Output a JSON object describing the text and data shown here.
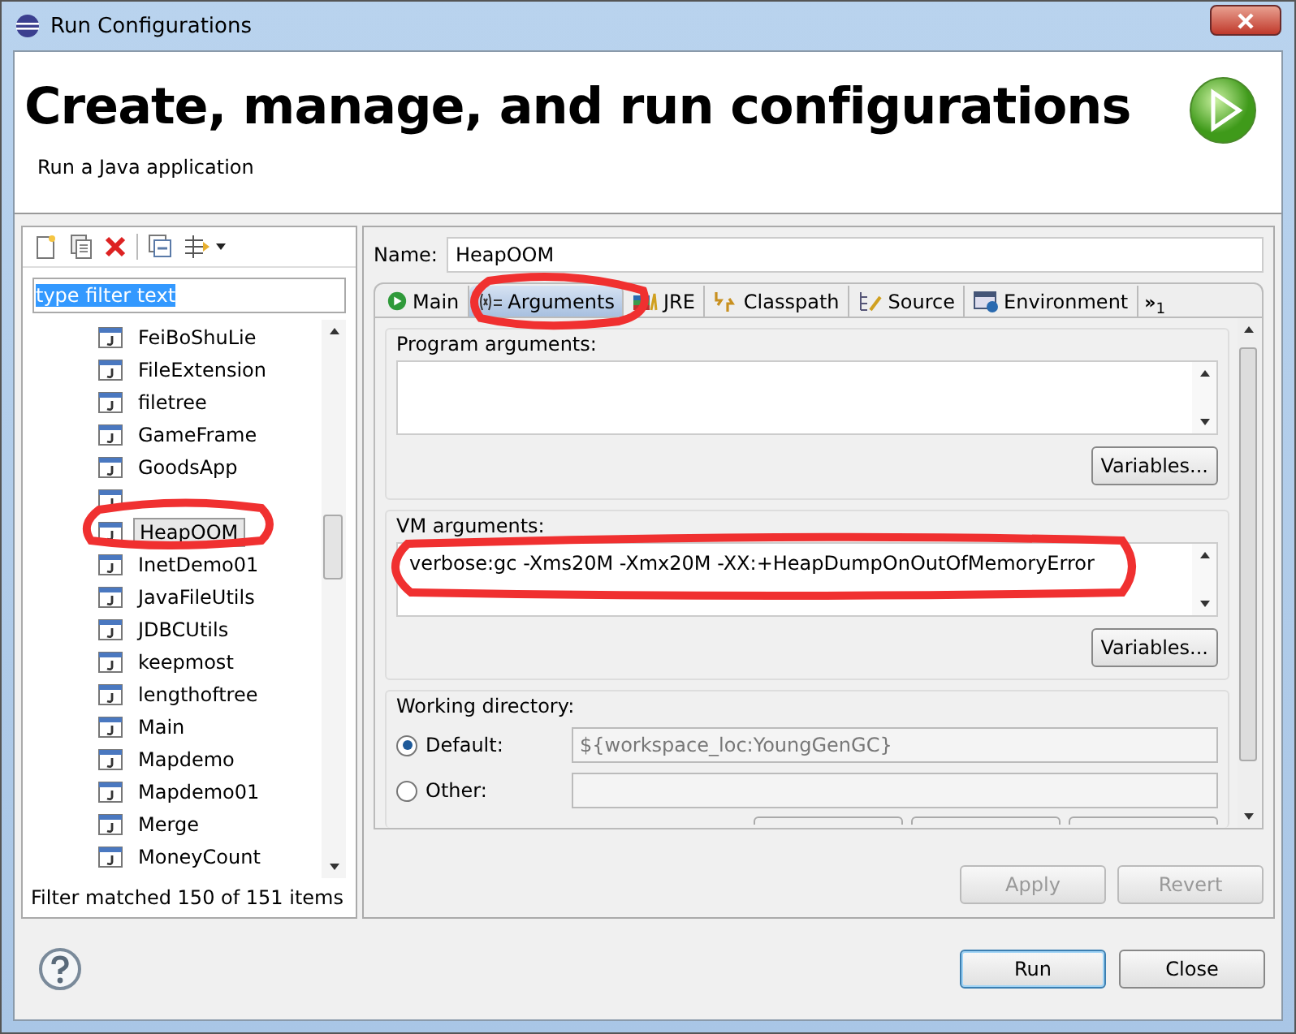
{
  "window": {
    "title": "Run Configurations"
  },
  "banner": {
    "heading": "Create, manage, and run configurations",
    "subtitle": "Run a Java application"
  },
  "filter": {
    "value": "type filter text"
  },
  "tree": {
    "items": [
      {
        "label": "FeiBoShuLie",
        "selected": false
      },
      {
        "label": "FileExtension",
        "selected": false
      },
      {
        "label": "filetree",
        "selected": false
      },
      {
        "label": "GameFrame",
        "selected": false
      },
      {
        "label": "GoodsApp",
        "selected": false
      },
      {
        "selected": false
      },
      {
        "label": "HeapOOM",
        "selected": true
      },
      {
        "label": "InetDemo01",
        "selected": false
      },
      {
        "label": "JavaFileUtils",
        "selected": false
      },
      {
        "label": "JDBCUtils",
        "selected": false
      },
      {
        "label": "keepmost",
        "selected": false
      },
      {
        "label": "lengthoftree",
        "selected": false
      },
      {
        "label": "Main",
        "selected": false
      },
      {
        "label": "Mapdemo",
        "selected": false
      },
      {
        "label": "Mapdemo01",
        "selected": false
      },
      {
        "label": "Merge",
        "selected": false
      },
      {
        "label": "MoneyCount",
        "selected": false
      }
    ]
  },
  "filter_status": "Filter matched 150 of 151 items",
  "name_field": {
    "label": "Name:",
    "value": "HeapOOM"
  },
  "tabs": [
    {
      "label": "Main",
      "kind": "main",
      "selected": false
    },
    {
      "label": "Arguments",
      "kind": "args",
      "selected": true
    },
    {
      "label": "JRE",
      "kind": "jre",
      "selected": false
    },
    {
      "label": "Classpath",
      "kind": "classpath",
      "selected": false
    },
    {
      "label": "Source",
      "kind": "source",
      "selected": false
    },
    {
      "label": "Environment",
      "kind": "env",
      "selected": false
    }
  ],
  "tabs_overflow": {
    "label": "»",
    "count": "1"
  },
  "program_arguments": {
    "label": "Program arguments:",
    "button": "Variables..."
  },
  "vm_arguments": {
    "label": "VM arguments:",
    "value": "verbose:gc -Xms20M -Xmx20M -XX:+HeapDumpOnOutOfMemoryError",
    "button": "Variables..."
  },
  "working_directory": {
    "label": "Working directory:",
    "options": [
      {
        "label": "Default:",
        "value": "${workspace_loc:YoungGenGC}",
        "disabled": true,
        "selected": true
      },
      {
        "label": "Other:",
        "selected": false
      }
    ]
  },
  "panel_buttons": [
    {
      "label": "Apply",
      "disabled": true
    },
    {
      "label": "Revert",
      "disabled": true
    }
  ],
  "dialog_buttons": [
    {
      "label": "Run",
      "default": true
    },
    {
      "label": "Close",
      "default": false
    }
  ]
}
